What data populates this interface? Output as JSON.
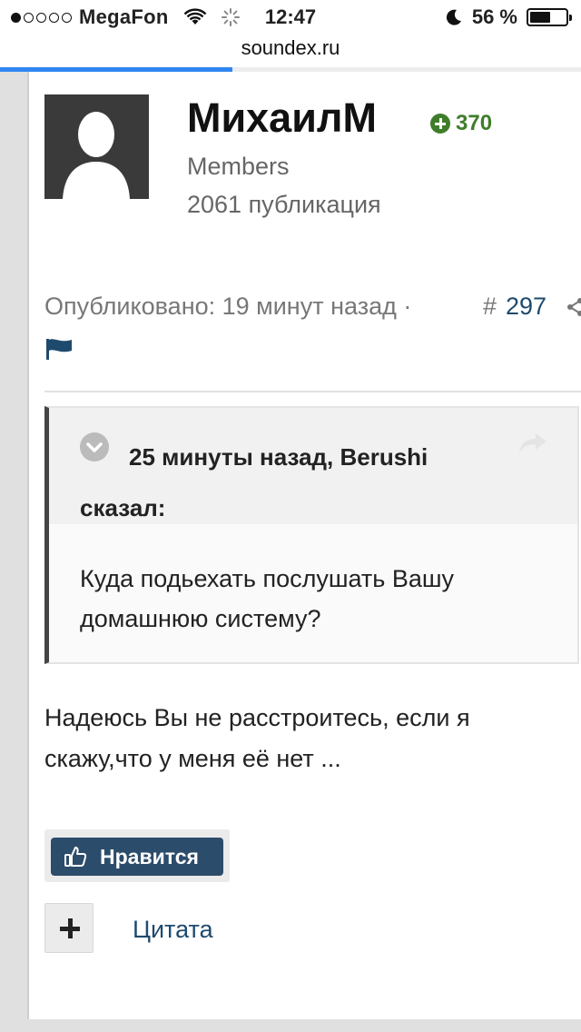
{
  "status_bar": {
    "signal_dots": [
      true,
      false,
      false,
      false,
      false
    ],
    "carrier": "MegaFon",
    "time": "12:47",
    "battery": "56 %"
  },
  "browser": {
    "url": "soundex.ru",
    "load_progress": 0.4
  },
  "author": {
    "name": "МихаилМ",
    "reputation": "370",
    "group": "Members",
    "posts": "2061 публикация"
  },
  "meta": {
    "published": "Опубликовано: 19 минут назад ·",
    "hash": "#",
    "post_number": "297"
  },
  "quote": {
    "header_line1": "25 минуты назад, Berushi",
    "header_line2": "сказал:",
    "body": "Куда подьехать послушать Вашу домашнюю систему?"
  },
  "post": {
    "text": "Надеюсь Вы не расстроитесь, если я скажу,что у меня её нет ..."
  },
  "actions": {
    "like_label": "Нравится",
    "quote_label": "Цитата"
  },
  "colors": {
    "accent": "#2c4c6b",
    "reputation": "#3f7d2b",
    "link": "#1e4a6e",
    "progress": "#2f86f0"
  }
}
